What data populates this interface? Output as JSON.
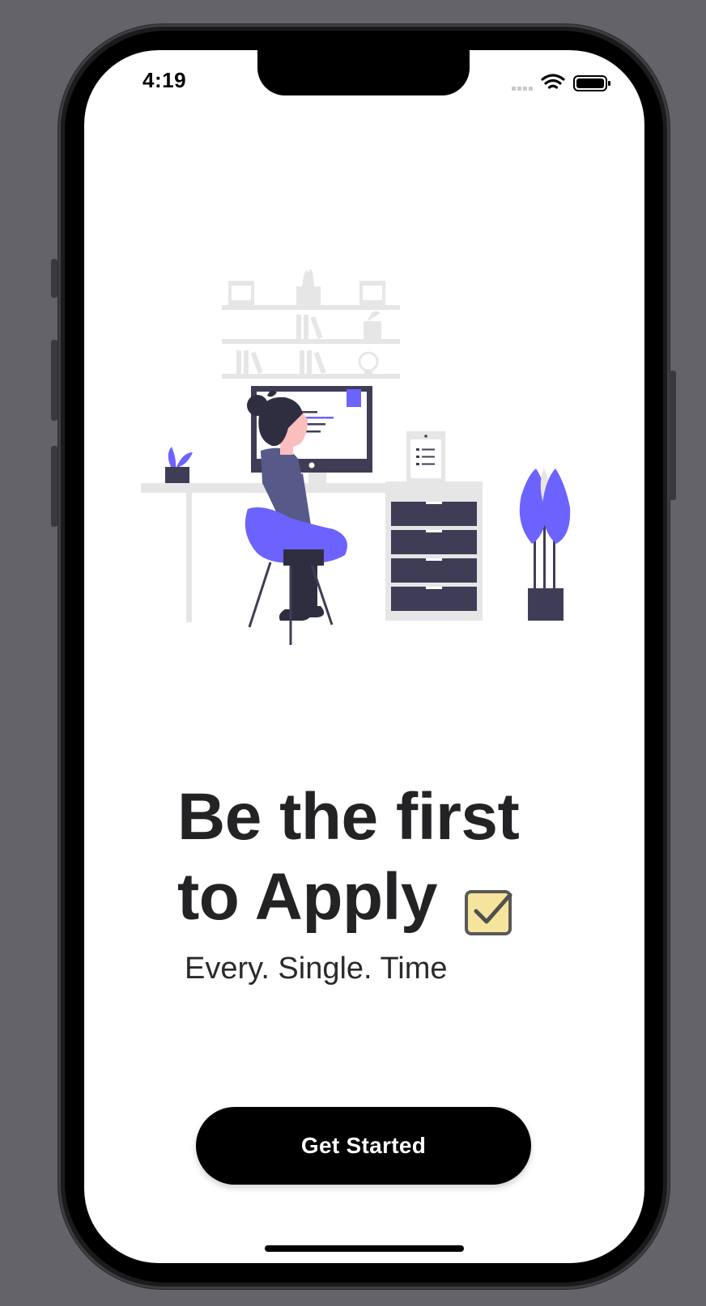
{
  "device": {
    "frame_color": "#1b1b1d",
    "background_color": "#646369"
  },
  "status_bar": {
    "time": "4:19",
    "icons": [
      "signal-icon",
      "wifi-icon",
      "battery-icon"
    ]
  },
  "illustration": {
    "name": "woman-at-desk-illustration",
    "accent_color": "#6c63ff",
    "dark_color": "#3f3d56"
  },
  "onboarding": {
    "headline_line1": "Be the first",
    "headline_line2": "to Apply",
    "headline_emoji": "check-box-icon",
    "subtitle": "Every. Single. Time",
    "cta_label": "Get Started",
    "cta_color": "#000000"
  }
}
